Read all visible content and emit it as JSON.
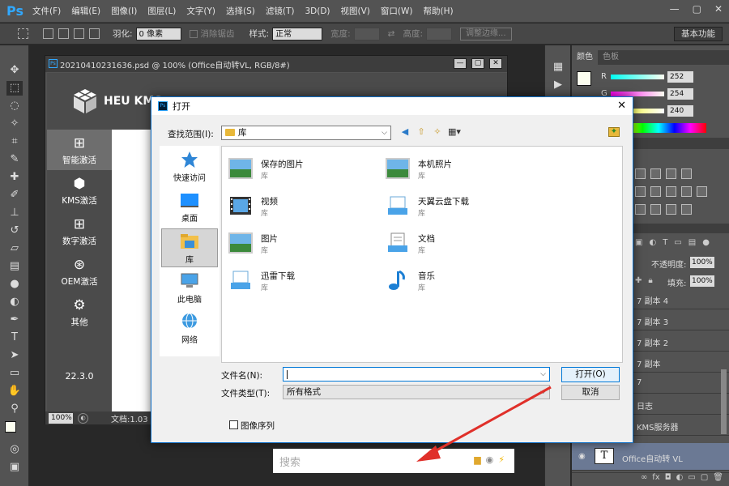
{
  "menubar": {
    "logo": "Ps",
    "items": [
      "文件(F)",
      "编辑(E)",
      "图像(I)",
      "图层(L)",
      "文字(Y)",
      "选择(S)",
      "滤镜(T)",
      "3D(D)",
      "视图(V)",
      "窗口(W)",
      "帮助(H)"
    ],
    "window_controls": [
      "—",
      "▢",
      "✕"
    ]
  },
  "options": {
    "feather_label": "羽化:",
    "feather_value": "0 像素",
    "antialias_label": "消除锯齿",
    "style_label": "样式:",
    "style_value": "正常",
    "width_label": "宽度:",
    "height_label": "高度:",
    "refine_edge": "调整边缘...",
    "workspace": "基本功能"
  },
  "document": {
    "title": "20210410231636.psd @ 100% (Office自动转VL, RGB/8#)",
    "zoom": "100%",
    "info": "文档:1.03"
  },
  "kms": {
    "brand": "HEU KMS",
    "items": [
      {
        "label": "智能激活",
        "icon": "windows-icon"
      },
      {
        "label": "KMS激活",
        "icon": "cube-icon"
      },
      {
        "label": "数字激活",
        "icon": "windows-icon"
      },
      {
        "label": "OEM激活",
        "icon": "windows-circle-icon"
      },
      {
        "label": "其他",
        "icon": "gear-icon"
      }
    ],
    "version": "22.3.0"
  },
  "panels": {
    "color_tab": "颜色",
    "swatches_tab": "色板",
    "r_label": "R",
    "g_label": "G",
    "b_label": "B",
    "r_value": "252",
    "g_value": "254",
    "b_value": "240",
    "opacity_label": "不透明度:",
    "opacity_value": "100%",
    "fill_label": "填充:",
    "fill_value": "100%",
    "layers": [
      "7 副本 4",
      "7 副本 3",
      "7 副本 2",
      "7 副本",
      "7",
      "日志",
      "KMS服务器",
      "Office自动转 VL"
    ]
  },
  "dialog": {
    "title": "打开",
    "lookin_label": "查找范围(I):",
    "lookin_value": "库",
    "places": [
      "快速访问",
      "桌面",
      "库",
      "此电脑",
      "网络"
    ],
    "files": [
      {
        "name": "保存的图片",
        "type": "库"
      },
      {
        "name": "本机照片",
        "type": "库"
      },
      {
        "name": "视频",
        "type": "库"
      },
      {
        "name": "天翼云盘下载",
        "type": "库"
      },
      {
        "name": "图片",
        "type": "库"
      },
      {
        "name": "文档",
        "type": "库"
      },
      {
        "name": "迅雷下载",
        "type": "库"
      },
      {
        "name": "音乐",
        "type": "库"
      }
    ],
    "filename_label": "文件名(N):",
    "filename_value": "",
    "filetype_label": "文件类型(T):",
    "filetype_value": "所有格式",
    "open_button": "打开(O)",
    "cancel_button": "取消",
    "image_sequence": "图像序列"
  },
  "search": {
    "placeholder": "搜索"
  }
}
